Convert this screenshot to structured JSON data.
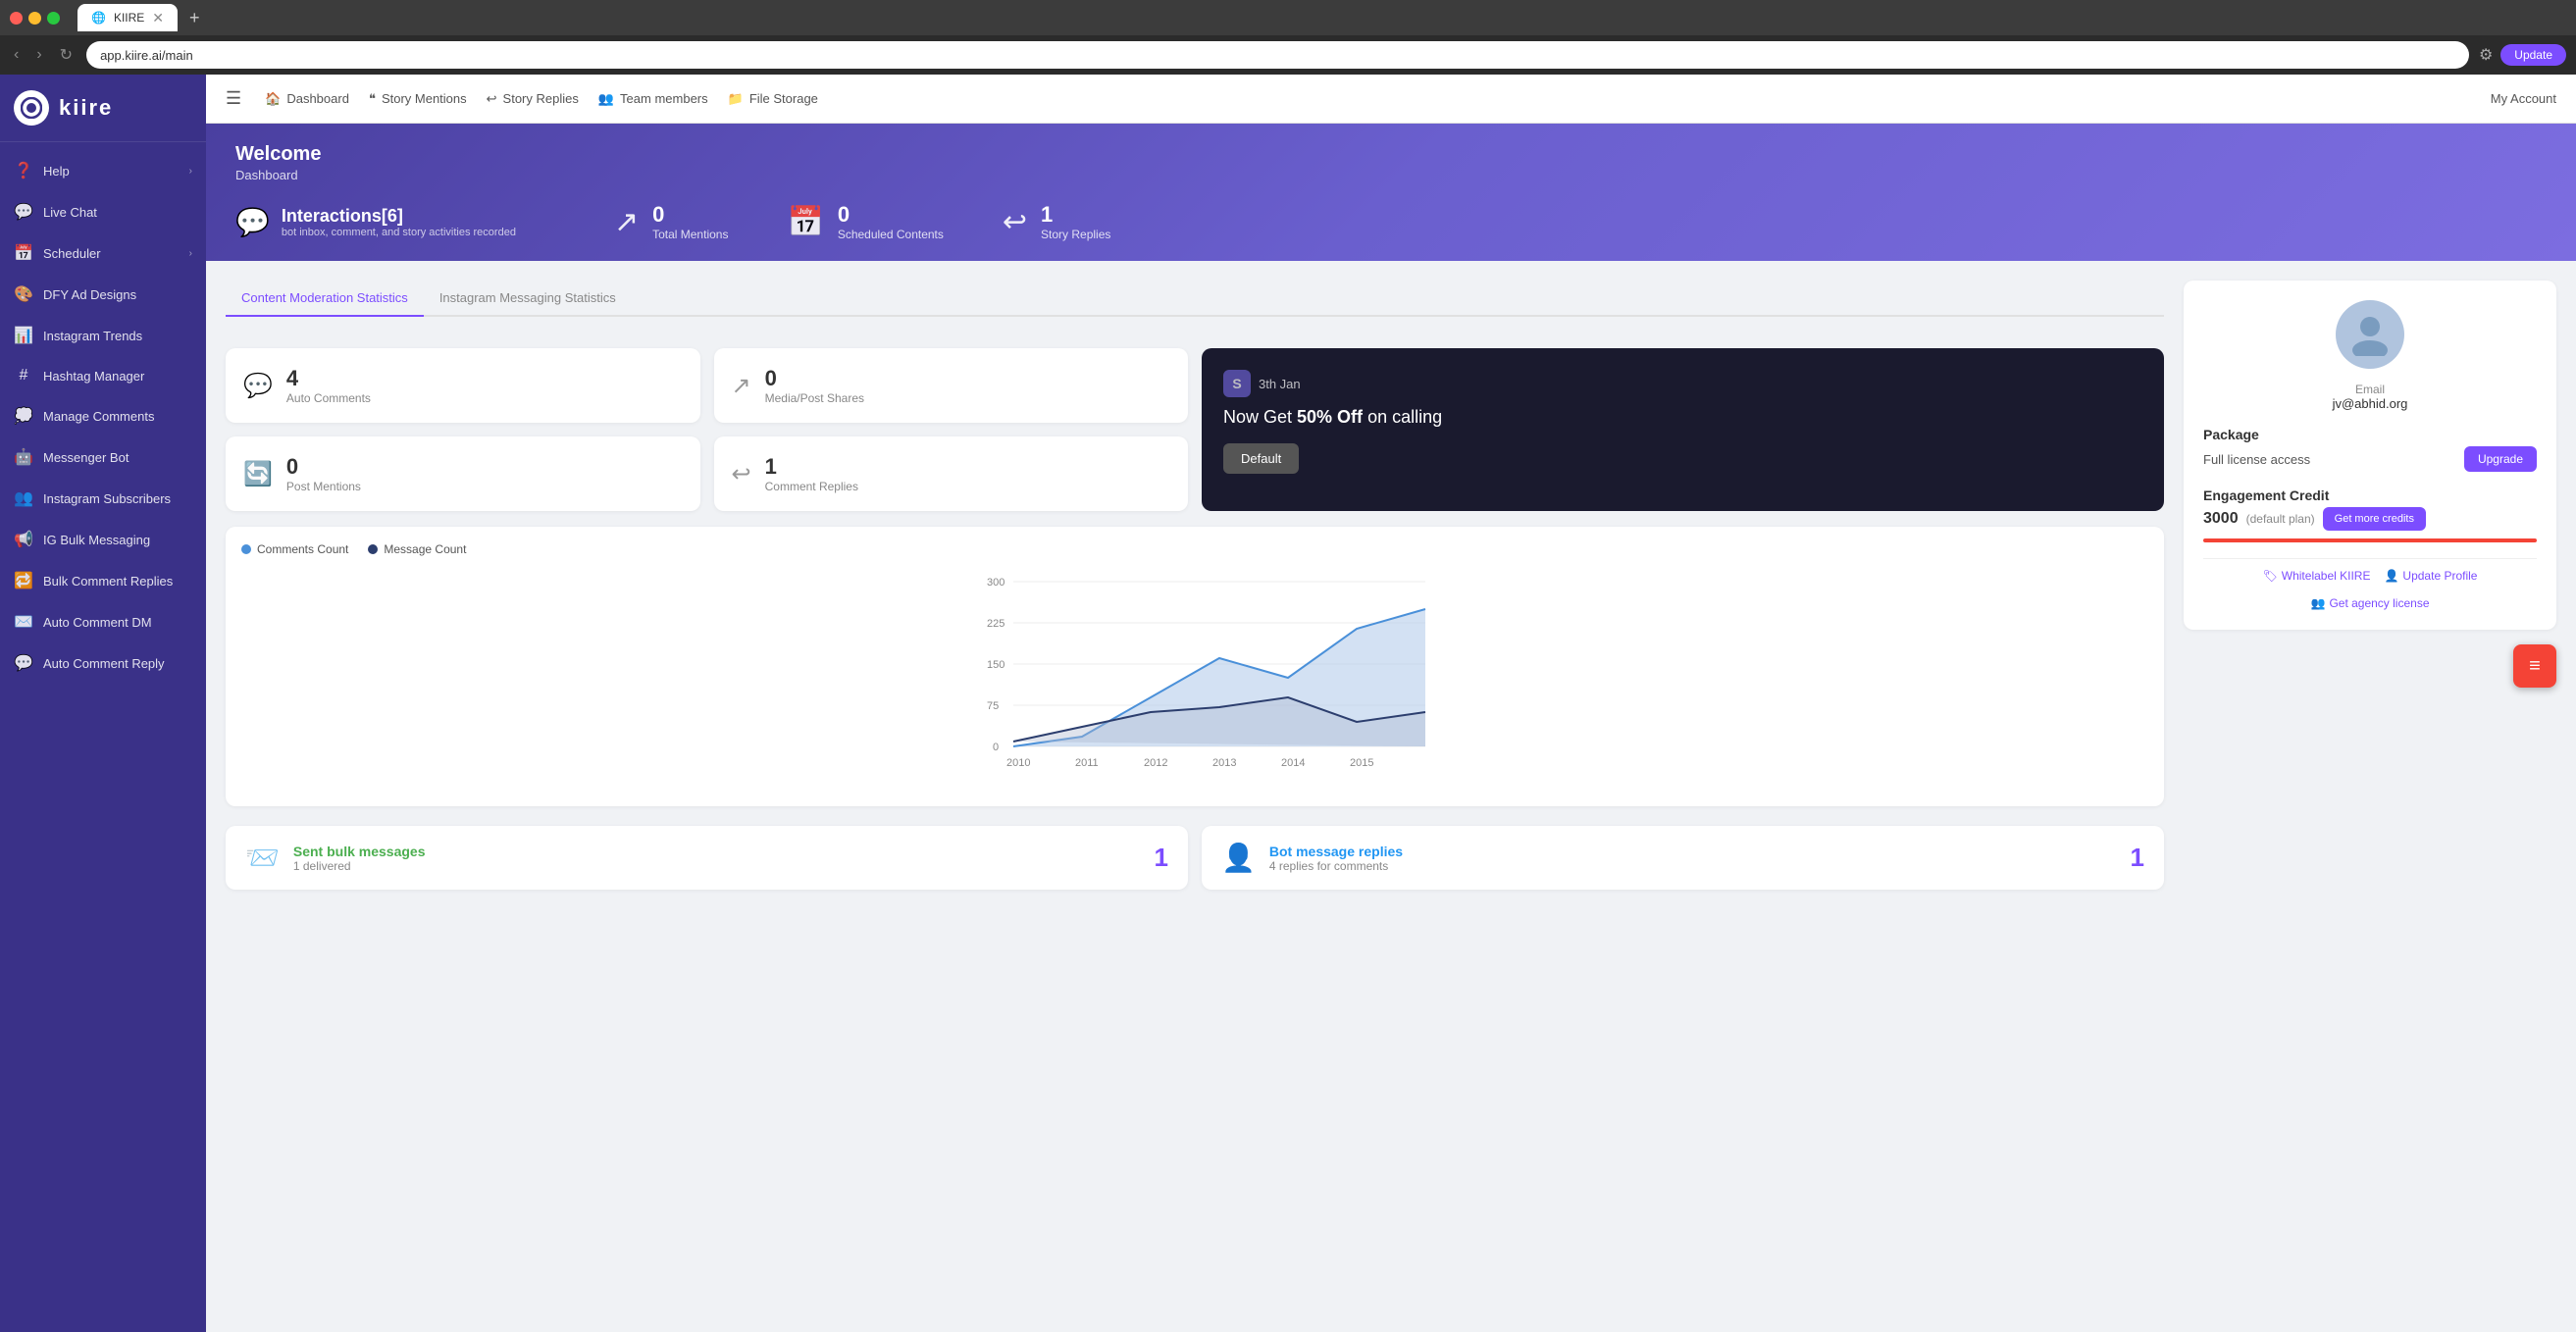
{
  "browser": {
    "url": "app.kiire.ai/main",
    "tab_title": "KIIRE",
    "update_label": "Update"
  },
  "sidebar": {
    "logo_text": "kiire",
    "items": [
      {
        "id": "help",
        "label": "Help",
        "icon": "❓",
        "has_arrow": true
      },
      {
        "id": "live-chat",
        "label": "Live Chat",
        "icon": "💬",
        "has_arrow": false
      },
      {
        "id": "scheduler",
        "label": "Scheduler",
        "icon": "📅",
        "has_arrow": true
      },
      {
        "id": "dfy-ad",
        "label": "DFY Ad Designs",
        "icon": "🎨",
        "has_arrow": false
      },
      {
        "id": "instagram-trends",
        "label": "Instagram Trends",
        "icon": "📊",
        "has_arrow": false
      },
      {
        "id": "hashtag",
        "label": "Hashtag Manager",
        "icon": "#",
        "has_arrow": false
      },
      {
        "id": "manage-comments",
        "label": "Manage Comments",
        "icon": "💭",
        "has_arrow": false
      },
      {
        "id": "messenger-bot",
        "label": "Messenger Bot",
        "icon": "🤖",
        "has_arrow": false
      },
      {
        "id": "instagram-subscribers",
        "label": "Instagram Subscribers",
        "icon": "👥",
        "has_arrow": false
      },
      {
        "id": "ig-bulk",
        "label": "IG Bulk Messaging",
        "icon": "📢",
        "has_arrow": false
      },
      {
        "id": "bulk-comment",
        "label": "Bulk Comment Replies",
        "icon": "🔁",
        "has_arrow": false
      },
      {
        "id": "auto-comment-dm",
        "label": "Auto Comment DM",
        "icon": "✉️",
        "has_arrow": false
      },
      {
        "id": "auto-comment-reply",
        "label": "Auto Comment Reply",
        "icon": "💬",
        "has_arrow": false
      }
    ]
  },
  "topnav": {
    "menu_icon": "☰",
    "links": [
      {
        "id": "dashboard",
        "label": "Dashboard",
        "icon": "🏠"
      },
      {
        "id": "story-mentions",
        "label": "Story Mentions",
        "icon": "❝"
      },
      {
        "id": "story-replies",
        "label": "Story Replies",
        "icon": "↩"
      },
      {
        "id": "team-members",
        "label": "Team members",
        "icon": "👥"
      },
      {
        "id": "file-storage",
        "label": "File Storage",
        "icon": "📁"
      }
    ],
    "my_account": "My Account"
  },
  "header": {
    "welcome": "Welcome",
    "subtitle": "Dashboard",
    "interactions_label": "Interactions[6]",
    "interactions_sub": "bot inbox, comment, and story activities recorded",
    "stats": [
      {
        "id": "total-mentions",
        "num": "0",
        "label": "Total Mentions",
        "icon": "↗"
      },
      {
        "id": "scheduled-contents",
        "num": "0",
        "label": "Scheduled Contents",
        "icon": "📅"
      },
      {
        "id": "story-replies",
        "num": "1",
        "label": "Story Replies",
        "icon": "↩"
      }
    ]
  },
  "tabs": [
    {
      "id": "content-moderation",
      "label": "Content Moderation Statistics",
      "active": true
    },
    {
      "id": "instagram-messaging",
      "label": "Instagram Messaging Statistics",
      "active": false
    }
  ],
  "stat_cards": [
    {
      "id": "auto-comments",
      "num": "4",
      "label": "Auto Comments",
      "icon": "💬"
    },
    {
      "id": "media-shares",
      "num": "0",
      "label": "Media/Post Shares",
      "icon": "↗"
    },
    {
      "id": "post-mentions",
      "num": "0",
      "label": "Post Mentions",
      "icon": "🔄"
    },
    {
      "id": "comment-replies",
      "num": "1",
      "label": "Comment Replies",
      "icon": "↩"
    }
  ],
  "promo": {
    "date": "3th Jan",
    "logo": "S",
    "title_pre": "Now Get ",
    "title_bold": "50% Off",
    "title_post": " on calling",
    "btn_label": "Default"
  },
  "chart": {
    "legend": [
      {
        "id": "comments-count",
        "label": "Comments Count",
        "color": "#4a90d9"
      },
      {
        "id": "message-count",
        "label": "Message Count",
        "color": "#2c3e6e"
      }
    ],
    "y_labels": [
      "300",
      "225",
      "150",
      "75",
      "0"
    ],
    "x_labels": [
      "2010",
      "2011",
      "2012",
      "2013",
      "2014",
      "2015"
    ]
  },
  "bottom_cards": [
    {
      "id": "sent-bulk",
      "icon": "📨",
      "title": "Sent bulk messages",
      "sub": "1 delivered",
      "num": "1",
      "title_color": "green"
    },
    {
      "id": "bot-replies",
      "icon": "👤",
      "title": "Bot message replies",
      "sub": "4 replies for comments",
      "num": "1",
      "title_color": "blue"
    }
  ],
  "user_panel": {
    "email_label": "Email",
    "email": "jv@abhid.org",
    "package_label": "Package",
    "package_value": "Full license access",
    "upgrade_btn": "Upgrade",
    "credit_label": "Engagement Credit",
    "credit_num": "3000",
    "credit_plan": "(default plan)",
    "get_credits_btn": "Get more credits",
    "footer_links": [
      {
        "id": "whitelabel",
        "label": "Whitelabel KIIRE",
        "icon": "🏷"
      },
      {
        "id": "update-profile",
        "label": "Update Profile",
        "icon": "👤"
      },
      {
        "id": "agency-license",
        "label": "Get agency license",
        "icon": "👥"
      }
    ]
  },
  "fab": {
    "icon": "≡"
  }
}
